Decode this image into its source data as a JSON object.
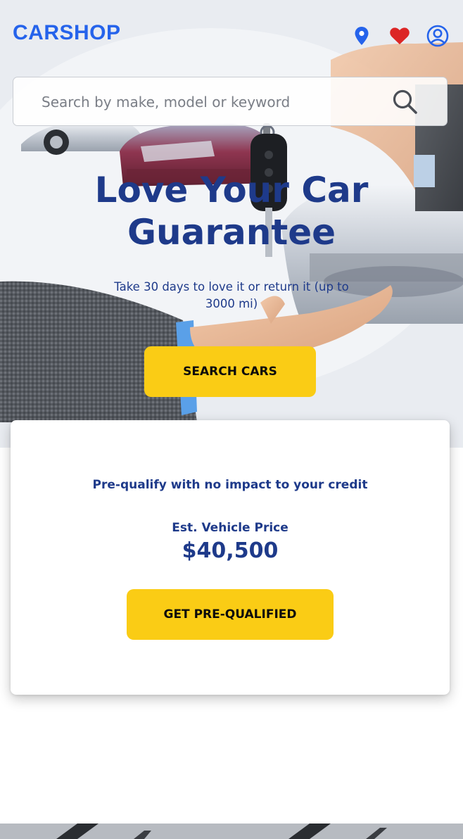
{
  "header": {
    "logo": "CARSHOP",
    "icons": [
      "location-pin-icon",
      "heart-icon",
      "user-account-icon"
    ]
  },
  "search": {
    "placeholder": "Search by make, model or keyword",
    "icon": "search-icon"
  },
  "hero": {
    "title_line1": "Love Your Car",
    "title_line2": "Guarantee",
    "subtitle": "Take 30 days to love it or return it (up to 3000 mi)",
    "cta_label": "SEARCH CARS"
  },
  "card": {
    "headline": "Pre-qualify with no impact to your credit",
    "price_label": "Est. Vehicle Price",
    "price_value": "$40,500",
    "cta_label": "GET PRE-QUALIFIED"
  },
  "colors": {
    "brand": "#2563eb",
    "navy": "#1e3a8a",
    "cta": "#facc15",
    "heart": "#dc2626"
  }
}
